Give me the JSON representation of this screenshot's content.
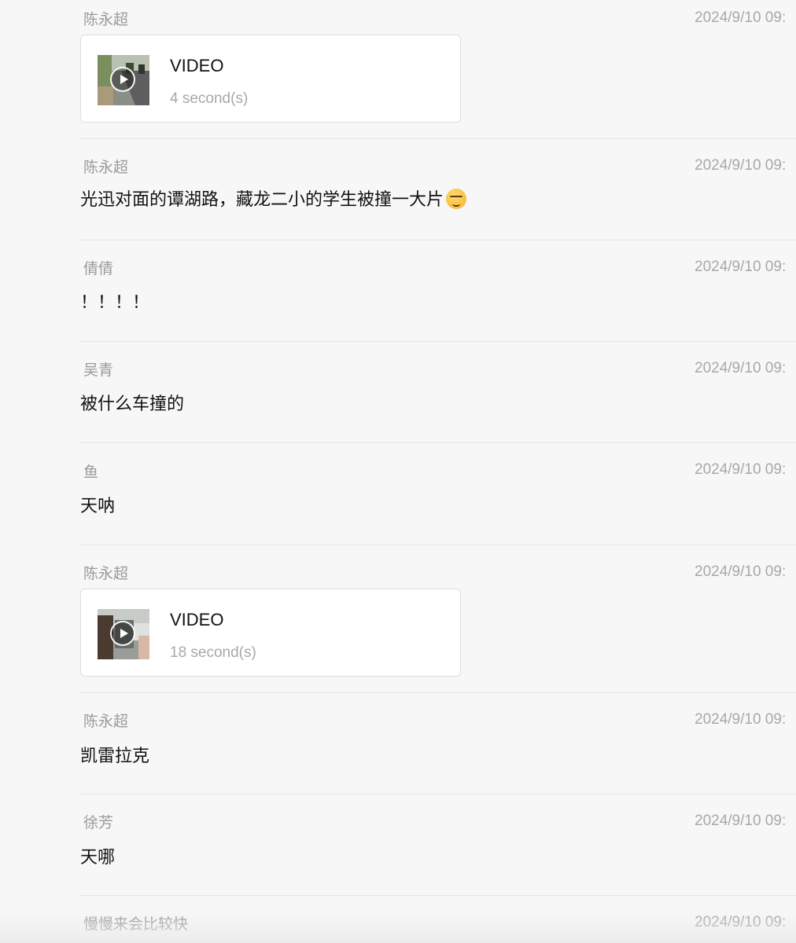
{
  "messages": [
    {
      "sender": "陈永超",
      "time": "2024/9/10 09:",
      "type": "video",
      "video_label": "VIDEO",
      "duration": "4 second(s)"
    },
    {
      "sender": "陈永超",
      "time": "2024/9/10 09:",
      "type": "text",
      "text": "光迅对面的谭湖路，藏龙二小的学生被撞一大片",
      "emoji": "persevering-face-emoji"
    },
    {
      "sender": "倩倩",
      "time": "2024/9/10 09:",
      "type": "text",
      "text": "！！！！"
    },
    {
      "sender": "吴青",
      "time": "2024/9/10 09:",
      "type": "text",
      "text": "被什么车撞的"
    },
    {
      "sender": "鱼",
      "time": "2024/9/10 09:",
      "type": "text",
      "text": "天呐"
    },
    {
      "sender": "陈永超",
      "time": "2024/9/10 09:",
      "type": "video",
      "video_label": "VIDEO",
      "duration": "18 second(s)"
    },
    {
      "sender": "陈永超",
      "time": "2024/9/10 09:",
      "type": "text",
      "text": "凯雷拉克"
    },
    {
      "sender": "徐芳",
      "time": "2024/9/10 09:",
      "type": "text",
      "text": "天哪"
    },
    {
      "sender": "慢慢来会比较快",
      "time": "2024/9/10 09:",
      "type": "text",
      "text": ""
    }
  ],
  "colors": {
    "background": "#f7f7f7",
    "sender": "#9a9a9a",
    "time": "#a8a8a8",
    "text": "#111111",
    "divider": "#e6e6e6"
  }
}
